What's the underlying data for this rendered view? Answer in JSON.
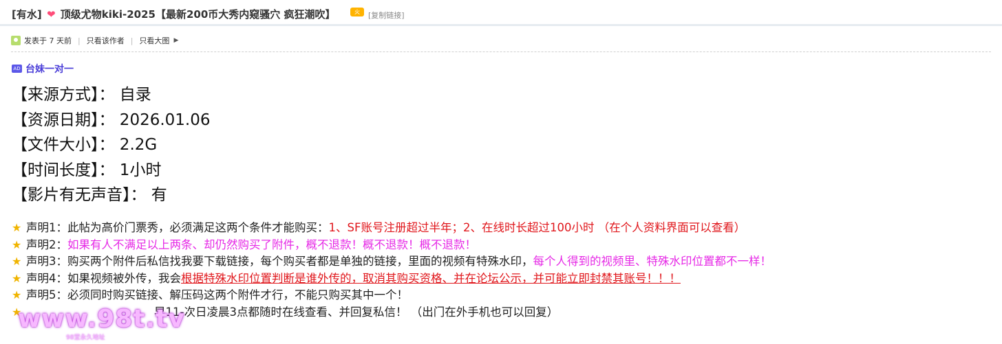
{
  "header": {
    "prefix": "[有水]",
    "title": "顶级尤物kiki-2025【最新200币大秀内窥骚穴 疯狂潮吹】",
    "hot_label": "火",
    "copy_link": "[复制链接]"
  },
  "meta": {
    "posted": "发表于 7 天前",
    "only_author": "只看该作者",
    "only_large_image": "只看大图"
  },
  "ad": {
    "badge": "AD",
    "text": "台妹一对一"
  },
  "info_lines": [
    "【来源方式】： 自录",
    "【资源日期】： 2026.01.06",
    "【文件大小】： 2.2G",
    "【时间长度】： 1小时",
    "【影片有无声音】： 有"
  ],
  "statements": {
    "s1_a": "声明1：此帖为高价门票秀，必须满足这两个条件才能购买：",
    "s1_b": "1、SF账号注册超过半年；2、在线时长超过100小时 （在个人资料界面可以查看）",
    "s2_a": "声明2：",
    "s2_b": "如果有人不满足以上两条、却仍然购买了附件，概不退款！概不退款！概不退款！",
    "s3_a": "声明3：购买两个附件后私信找我要下载链接，每个购买者都是单独的链接，里面的视频有特殊水印，",
    "s3_b": "每个人得到的视频里、特殊水印位置都不一样！",
    "s4_a": "声明4：如果视频被外传，我会",
    "s4_b": "根据特殊水印位置判断是谁外传的，取消其购买资格、并在论坛公示，并可能立即封禁其账号！！！",
    "s5": "声明5：必须同时购买链接、解压码这两个附件才行，不能只购买其中一个！",
    "s6": "早11-次日凌晨3点都随时在线查看、并回复私信！ （出门在外手机也可以回复）"
  },
  "watermark": {
    "main": "www.98t.tv",
    "sub": "98堂永久地址"
  }
}
